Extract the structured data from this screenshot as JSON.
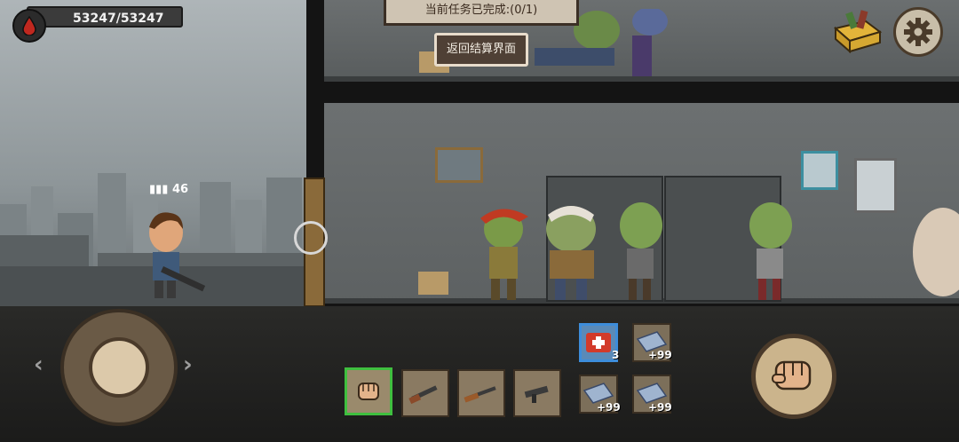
{
  "hud": {
    "health_text": "53247/53247",
    "ammo_count": "46",
    "task_notice": "当前任务已完成:(0/1)",
    "return_button_label": "返回结算界面"
  },
  "weapons": {
    "slots": [
      {
        "name": "fist",
        "selected": true
      },
      {
        "name": "shotgun",
        "selected": false
      },
      {
        "name": "rifle",
        "selected": false
      },
      {
        "name": "smg",
        "selected": false
      }
    ]
  },
  "items": [
    {
      "name": "medkit",
      "count": "3"
    },
    {
      "name": "blueprint",
      "count": "+99"
    },
    {
      "name": "blueprint",
      "count": "+99"
    },
    {
      "name": "blueprint",
      "count": "+99"
    }
  ],
  "colors": {
    "selected_slot": "#3fbf3f",
    "medkit_border": "#3d8ddb",
    "blood": "#c0281f"
  }
}
